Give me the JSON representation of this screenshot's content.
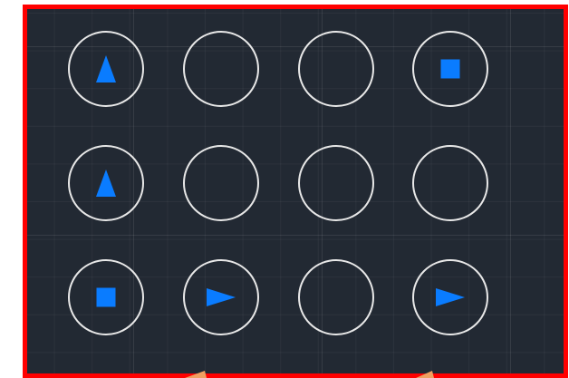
{
  "board": {
    "background_color": "#222933",
    "border_color": "#ff0000",
    "circle_color": "#e8e8e8",
    "symbol_color": "#0a7cff",
    "rows": 3,
    "columns": 4,
    "cells": [
      {
        "row": 1,
        "col": 1,
        "symbol": "triangle-up"
      },
      {
        "row": 1,
        "col": 2,
        "symbol": "empty"
      },
      {
        "row": 1,
        "col": 3,
        "symbol": "empty"
      },
      {
        "row": 1,
        "col": 4,
        "symbol": "square"
      },
      {
        "row": 2,
        "col": 1,
        "symbol": "triangle-up"
      },
      {
        "row": 2,
        "col": 2,
        "symbol": "empty"
      },
      {
        "row": 2,
        "col": 3,
        "symbol": "empty"
      },
      {
        "row": 2,
        "col": 4,
        "symbol": "empty"
      },
      {
        "row": 3,
        "col": 1,
        "symbol": "square"
      },
      {
        "row": 3,
        "col": 2,
        "symbol": "triangle-right"
      },
      {
        "row": 3,
        "col": 3,
        "symbol": "empty"
      },
      {
        "row": 3,
        "col": 4,
        "symbol": "triangle-right"
      }
    ]
  },
  "cursor_color": "#f0a060"
}
